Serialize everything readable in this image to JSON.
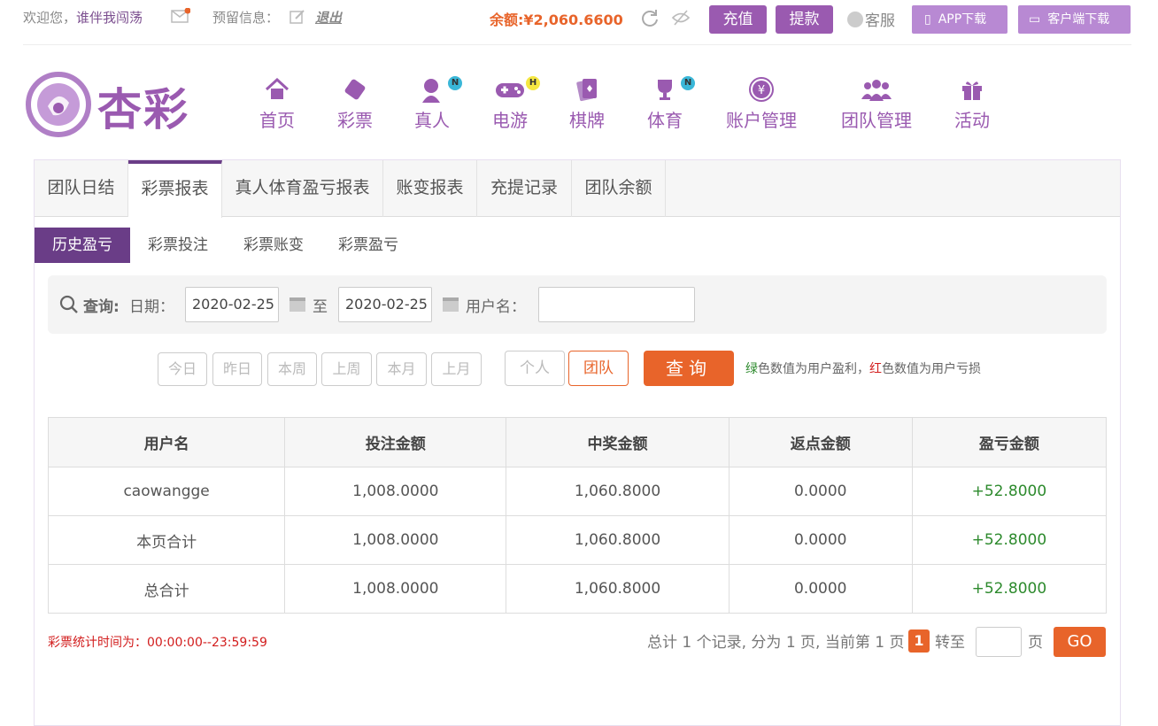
{
  "topbar": {
    "welcome": "欢迎您，",
    "username": "谁伴我闯荡",
    "reserved_info": "预留信息：",
    "logout": "退出",
    "balance_label": "余额:",
    "balance_value": "¥2,060.6600",
    "recharge": "充值",
    "withdraw": "提款",
    "service": "客服",
    "app_download": "APP下载",
    "client_download": "客户端下载"
  },
  "logo": {
    "text": "杏彩"
  },
  "nav": {
    "items": [
      {
        "label": "首页",
        "icon": "home-icon"
      },
      {
        "label": "彩票",
        "icon": "lottery-ticket-icon"
      },
      {
        "label": "真人",
        "icon": "live-dealer-icon",
        "badge": "N"
      },
      {
        "label": "电游",
        "icon": "gamepad-icon",
        "badge": "H"
      },
      {
        "label": "棋牌",
        "icon": "cards-icon"
      },
      {
        "label": "体育",
        "icon": "trophy-icon",
        "badge": "N"
      },
      {
        "label": "账户管理",
        "icon": "yen-icon"
      },
      {
        "label": "团队管理",
        "icon": "team-icon"
      },
      {
        "label": "活动",
        "icon": "gift-icon"
      }
    ]
  },
  "tabs": [
    "团队日结",
    "彩票报表",
    "真人体育盈亏报表",
    "账变报表",
    "充提记录",
    "团队余额"
  ],
  "active_tab": "彩票报表",
  "subtabs": [
    "历史盈亏",
    "彩票投注",
    "彩票账变",
    "彩票盈亏"
  ],
  "active_subtab": "历史盈亏",
  "query": {
    "label": "查询:",
    "date_label": "日期：",
    "start_date": "2020-02-25",
    "to_label": "至",
    "end_date": "2020-02-25",
    "username_label": "用户名："
  },
  "quick_buttons": [
    "今日",
    "昨日",
    "本周",
    "上周",
    "本月",
    "上月"
  ],
  "scope_buttons": [
    "个人",
    "团队"
  ],
  "search_button": "查询",
  "hint": {
    "green": "绿",
    "part1": "色数值为用户盈利，",
    "red": "红",
    "part2": "色数值为用户亏损"
  },
  "table": {
    "headers": [
      "用户名",
      "投注金额",
      "中奖金额",
      "返点金额",
      "盈亏金额"
    ],
    "rows": [
      [
        "caowangge",
        "1,008.0000",
        "1,060.8000",
        "0.0000",
        "+52.8000"
      ],
      [
        "本页合计",
        "1,008.0000",
        "1,060.8000",
        "0.0000",
        "+52.8000"
      ],
      [
        "总合计",
        "1,008.0000",
        "1,060.8000",
        "0.0000",
        "+52.8000"
      ]
    ]
  },
  "footnote": "彩票统计时间为：00:00:00--23:59:59",
  "pager": {
    "summary": "总计 1 个记录, 分为 1 页, 当前第 1 页",
    "current": "1",
    "goto_label": "转至",
    "page_label": "页",
    "go": "GO"
  },
  "colors": {
    "brand_purple": "#9a5ab0",
    "dark_purple": "#6a3d87",
    "accent_orange": "#e8642a",
    "profit_green": "#2d8a2d",
    "loss_red": "#d21d1d"
  }
}
